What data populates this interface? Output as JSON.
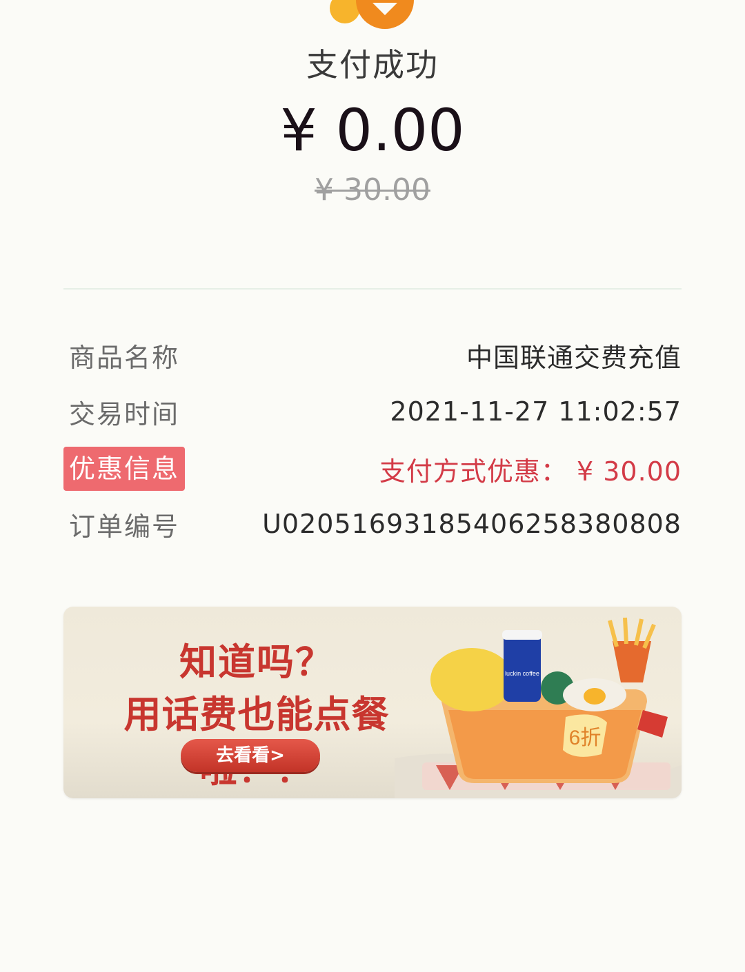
{
  "header": {
    "title": "支付成功",
    "amount": "¥ 0.00",
    "original_amount": "¥ 30.00"
  },
  "details": [
    {
      "label": "商品名称",
      "value": "中国联通交费充值"
    },
    {
      "label": "交易时间",
      "value": "2021-11-27 11:02:57"
    },
    {
      "label": "优惠信息",
      "value": "支付方式优惠：  ¥ 30.00"
    },
    {
      "label": "订单编号",
      "value": "U02051693185406258380808"
    }
  ],
  "banner": {
    "line1": "知道吗？",
    "line2": "用话费也能点餐啦！！",
    "cta": "去看看>",
    "badge": "6折",
    "cup_text": "luckin coffee"
  },
  "colors": {
    "accent_orange": "#f08a1e",
    "discount_red": "#d33b47",
    "label_badge": "#ee6a6f",
    "banner_red": "#c8362f"
  }
}
